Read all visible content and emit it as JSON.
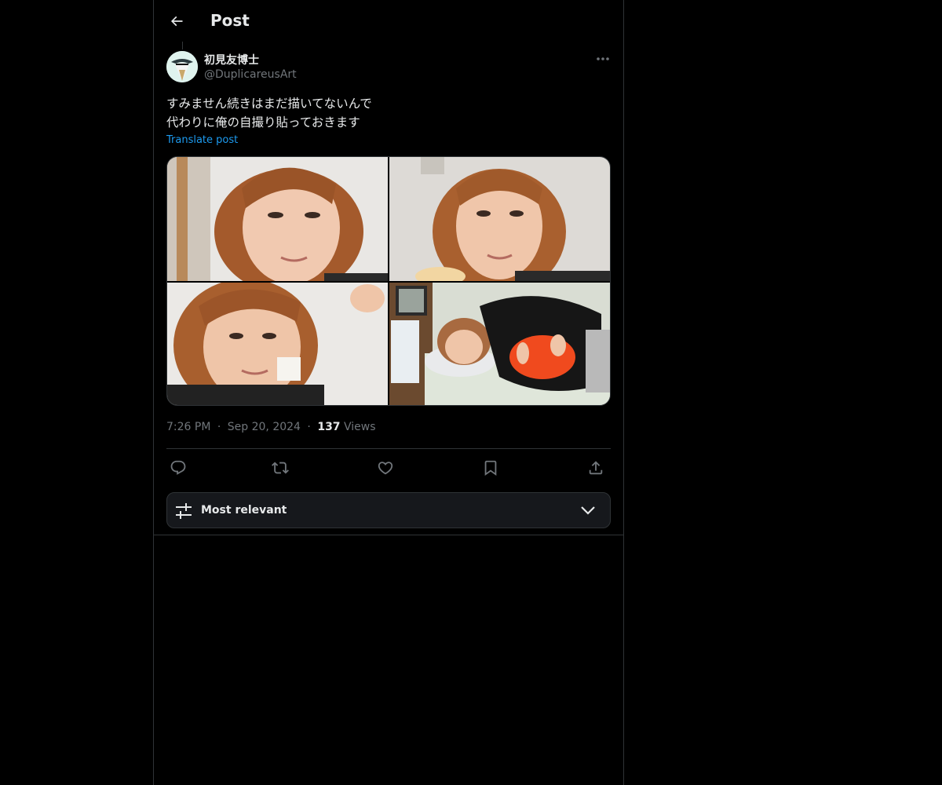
{
  "header": {
    "title": "Post",
    "back_icon": "arrow-left-icon"
  },
  "post": {
    "author": {
      "display_name": "初見友博士",
      "handle": "@DuplicareusArt",
      "avatar_icon": "avatar"
    },
    "text_lines": [
      "すみません続きはまだ描いてないんで",
      "代わりに俺の自撮り貼っておきます"
    ],
    "translate_label": "Translate post",
    "time": "7:26 PM",
    "separator": "·",
    "date": "Sep 20, 2024",
    "views_count": "137",
    "views_label": "Views",
    "media_count": 4
  },
  "actions": {
    "reply_icon": "reply-icon",
    "repost_icon": "repost-icon",
    "like_icon": "heart-icon",
    "bookmark_icon": "bookmark-icon",
    "share_icon": "share-icon"
  },
  "sort": {
    "label": "Most relevant",
    "icon": "sliders-icon",
    "chevron": "chevron-down-icon"
  },
  "colors": {
    "background": "#000000",
    "text": "#e7e9ea",
    "secondary_text": "#71767b",
    "accent": "#1d9bf0",
    "border": "#2f3336"
  }
}
